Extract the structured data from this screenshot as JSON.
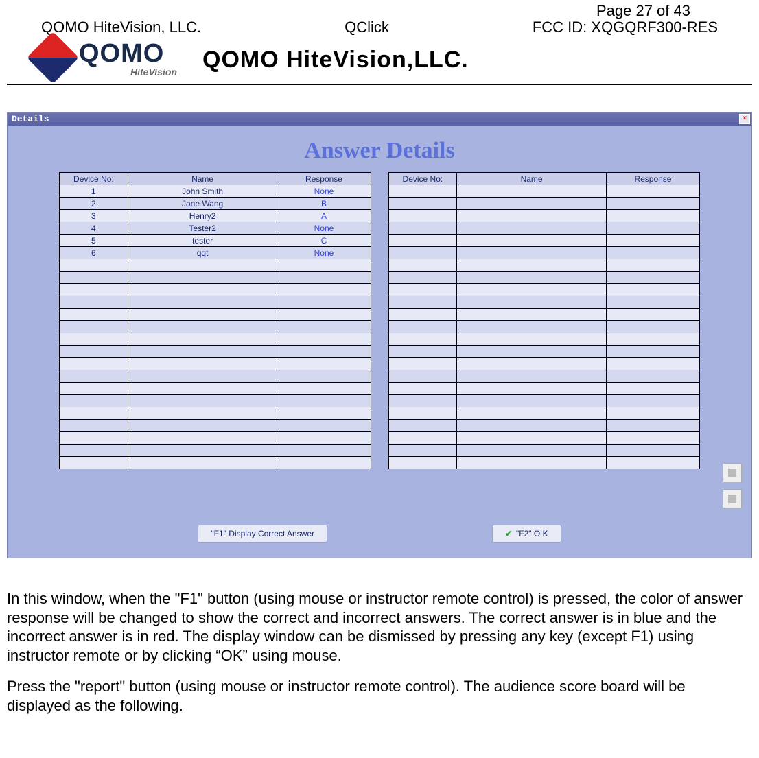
{
  "page_number": "Page 27 of 43",
  "header": {
    "left": "QOMO HiteVision, LLC.",
    "center": "QClick",
    "right": "FCC ID: XQGQRF300-RES"
  },
  "letterhead": {
    "logo_main": "QOMO",
    "logo_sub": "HiteVision",
    "company": "QOMO HiteVision,LLC."
  },
  "window": {
    "titlebar": "Details",
    "heading": "Answer Details",
    "columns": {
      "device": "Device No:",
      "name": "Name",
      "response": "Response"
    },
    "rows_left": [
      {
        "device": "1",
        "name": "John Smith",
        "response": "None"
      },
      {
        "device": "2",
        "name": "Jane Wang",
        "response": "B"
      },
      {
        "device": "3",
        "name": "Henry2",
        "response": "A"
      },
      {
        "device": "4",
        "name": "Tester2",
        "response": "None"
      },
      {
        "device": "5",
        "name": "tester",
        "response": "C"
      },
      {
        "device": "6",
        "name": "qqt",
        "response": "None"
      }
    ],
    "empty_rows_per_table": 23,
    "buttons": {
      "f1": "\"F1\"   Display Correct Answer",
      "f2": "\"F2\" O K"
    }
  },
  "body": {
    "p1": "In this window, when the \"F1\" button (using mouse or instructor remote control) is pressed, the color of answer response will be changed to show the correct and incorrect answers. The correct answer is in blue and the incorrect answer is in red. The display window can be dismissed by pressing any key (except F1) using instructor remote or by clicking “OK” using mouse.",
    "p2": "Press the \"report\" button (using mouse or instructor remote control). The audience score board will be displayed as the following."
  }
}
